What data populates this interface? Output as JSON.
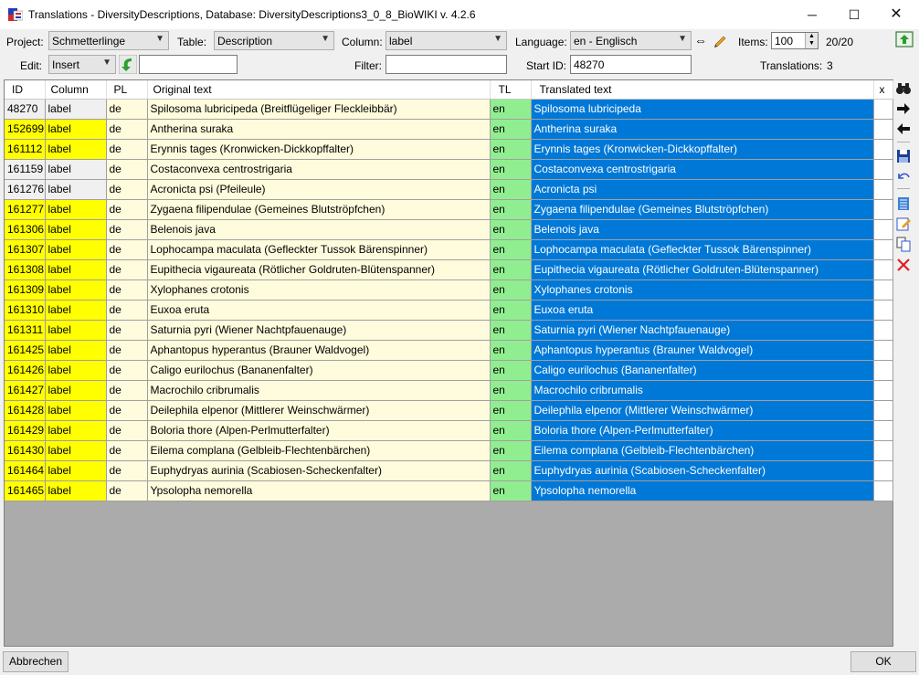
{
  "window": {
    "title": "Translations - DiversityDescriptions,  Database: DiversityDescriptions3_0_8_BioWIKI    v. 4.2.6",
    "minimize": "─",
    "maximize": "☐",
    "close": "✕"
  },
  "toolbar": {
    "project_label": "Project:",
    "project_value": "Schmetterlinge",
    "table_label": "Table:",
    "table_value": "Description",
    "column_label": "Column:",
    "column_value": "label",
    "language_label": "Language:",
    "language_value": "en - Englisch",
    "items_label": "Items:",
    "items_value": "100",
    "items_count": "20/20",
    "edit_label": "Edit:",
    "edit_value": "Insert",
    "edit_text": "",
    "filter_label": "Filter:",
    "filter_value": "",
    "startid_label": "Start ID:",
    "startid_value": "48270",
    "translations_label": "Translations:",
    "translations_value": "3",
    "colors": {
      "accent": "#0078d7",
      "highlight": "#ffff00",
      "lang_cell": "#90ee90",
      "original_cell": "#fffbdd"
    }
  },
  "grid": {
    "headers": {
      "id": "ID",
      "column": "Column",
      "pl": "PL",
      "original": "Original text",
      "tl": "TL",
      "translated": "Translated text",
      "x": "x"
    },
    "rows": [
      {
        "id": "48270",
        "column": "label",
        "pl": "de",
        "original": "Spilosoma lubricipeda (Breitflügeliger Fleckleibbär)",
        "tl": "en",
        "translated": "Spilosoma lubricipeda",
        "state": "translated"
      },
      {
        "id": "152699",
        "column": "label",
        "pl": "de",
        "original": "Antherina suraka",
        "tl": "en",
        "translated": "Antherina suraka",
        "state": "new"
      },
      {
        "id": "161112",
        "column": "label",
        "pl": "de",
        "original": "Erynnis tages (Kronwicken-Dickkopffalter)",
        "tl": "en",
        "translated": "Erynnis tages (Kronwicken-Dickkopffalter)",
        "state": "new"
      },
      {
        "id": "161159",
        "column": "label",
        "pl": "de",
        "original": "Costaconvexa centrostrigaria",
        "tl": "en",
        "translated": "Costaconvexa centrostrigaria",
        "state": "translated"
      },
      {
        "id": "161276",
        "column": "label",
        "pl": "de",
        "original": "Acronicta psi (Pfeileule)",
        "tl": "en",
        "translated": "Acronicta psi",
        "state": "translated"
      },
      {
        "id": "161277",
        "column": "label",
        "pl": "de",
        "original": "Zygaena filipendulae (Gemeines Blutströpfchen)",
        "tl": "en",
        "translated": "Zygaena filipendulae (Gemeines Blutströpfchen)",
        "state": "new"
      },
      {
        "id": "161306",
        "column": "label",
        "pl": "de",
        "original": "Belenois java",
        "tl": "en",
        "translated": "Belenois java",
        "state": "new"
      },
      {
        "id": "161307",
        "column": "label",
        "pl": "de",
        "original": "Lophocampa maculata (Gefleckter Tussok Bärenspinner)",
        "tl": "en",
        "translated": "Lophocampa maculata (Gefleckter Tussok Bärenspinner)",
        "state": "new"
      },
      {
        "id": "161308",
        "column": "label",
        "pl": "de",
        "original": "Eupithecia vigaureata (Rötlicher Goldruten-Blütenspanner)",
        "tl": "en",
        "translated": "Eupithecia vigaureata (Rötlicher Goldruten-Blütenspanner)",
        "state": "new"
      },
      {
        "id": "161309",
        "column": "label",
        "pl": "de",
        "original": "Xylophanes crotonis",
        "tl": "en",
        "translated": "Xylophanes crotonis",
        "state": "new"
      },
      {
        "id": "161310",
        "column": "label",
        "pl": "de",
        "original": "Euxoa eruta",
        "tl": "en",
        "translated": "Euxoa eruta",
        "state": "new"
      },
      {
        "id": "161311",
        "column": "label",
        "pl": "de",
        "original": "Saturnia pyri (Wiener Nachtpfauenauge)",
        "tl": "en",
        "translated": "Saturnia pyri (Wiener Nachtpfauenauge)",
        "state": "new"
      },
      {
        "id": "161425",
        "column": "label",
        "pl": "de",
        "original": "Aphantopus hyperantus (Brauner Waldvogel)",
        "tl": "en",
        "translated": "Aphantopus hyperantus (Brauner Waldvogel)",
        "state": "new"
      },
      {
        "id": "161426",
        "column": "label",
        "pl": "de",
        "original": "Caligo eurilochus (Bananenfalter)",
        "tl": "en",
        "translated": "Caligo eurilochus (Bananenfalter)",
        "state": "new"
      },
      {
        "id": "161427",
        "column": "label",
        "pl": "de",
        "original": "Macrochilo cribrumalis",
        "tl": "en",
        "translated": "Macrochilo cribrumalis",
        "state": "new"
      },
      {
        "id": "161428",
        "column": "label",
        "pl": "de",
        "original": "Deilephila elpenor (Mittlerer Weinschwärmer)",
        "tl": "en",
        "translated": "Deilephila elpenor (Mittlerer Weinschwärmer)",
        "state": "new"
      },
      {
        "id": "161429",
        "column": "label",
        "pl": "de",
        "original": "Boloria thore (Alpen-Perlmutterfalter)",
        "tl": "en",
        "translated": "Boloria thore (Alpen-Perlmutterfalter)",
        "state": "new"
      },
      {
        "id": "161430",
        "column": "label",
        "pl": "de",
        "original": "Eilema complana (Gelbleib-Flechtenbärchen)",
        "tl": "en",
        "translated": "Eilema complana (Gelbleib-Flechtenbärchen)",
        "state": "new"
      },
      {
        "id": "161464",
        "column": "label",
        "pl": "de",
        "original": "Euphydryas aurinia (Scabiosen-Scheckenfalter)",
        "tl": "en",
        "translated": "Euphydryas aurinia (Scabiosen-Scheckenfalter)",
        "state": "new"
      },
      {
        "id": "161465",
        "column": "label",
        "pl": "de",
        "original": "Ypsolopha nemorella",
        "tl": "en",
        "translated": "Ypsolopha nemorella",
        "state": "new"
      }
    ]
  },
  "sidebar_icons": [
    "binoculars-icon",
    "arrow-right-icon",
    "arrow-left-icon",
    "save-icon",
    "undo-icon",
    "list-icon",
    "edit-icon",
    "copy-icon",
    "delete-icon"
  ],
  "footer": {
    "cancel_label": "Abbrechen",
    "ok_label": "OK"
  }
}
